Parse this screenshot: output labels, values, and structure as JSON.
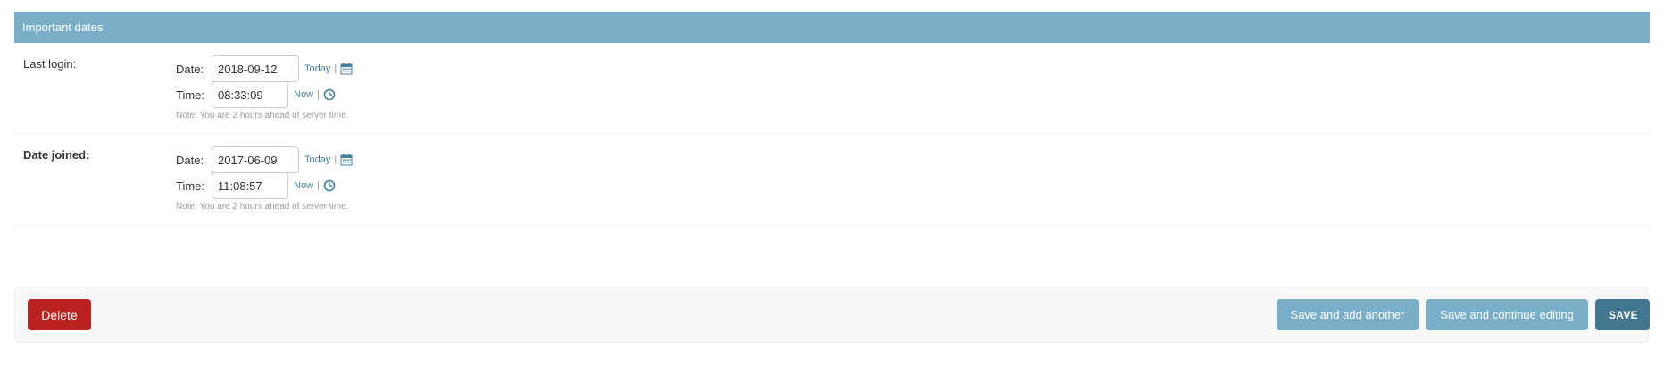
{
  "fieldset": {
    "title": "Important dates"
  },
  "last_login": {
    "label": "Last login:",
    "date_label": "Date:",
    "date_value": "2018-09-12",
    "today_label": "Today",
    "time_label": "Time:",
    "time_value": "08:33:09",
    "now_label": "Now",
    "separator": "|",
    "note": "Note: You are 2 hours ahead of server time."
  },
  "date_joined": {
    "label": "Date joined:",
    "date_label": "Date:",
    "date_value": "2017-06-09",
    "today_label": "Today",
    "time_label": "Time:",
    "time_value": "11:08:57",
    "now_label": "Now",
    "separator": "|",
    "note": "Note: You are 2 hours ahead of server time."
  },
  "submit_row": {
    "delete_label": "Delete",
    "save_add_another_label": "Save and add another",
    "save_continue_label": "Save and continue editing",
    "save_label": "SAVE"
  },
  "icons": {
    "calendar": "calendar-icon",
    "clock": "clock-icon"
  },
  "colors": {
    "header_bg": "#79aec8",
    "link": "#447e9b",
    "delete_bg": "#ba2121",
    "save_bg": "#417690",
    "secondary_bg": "#79aec8"
  }
}
